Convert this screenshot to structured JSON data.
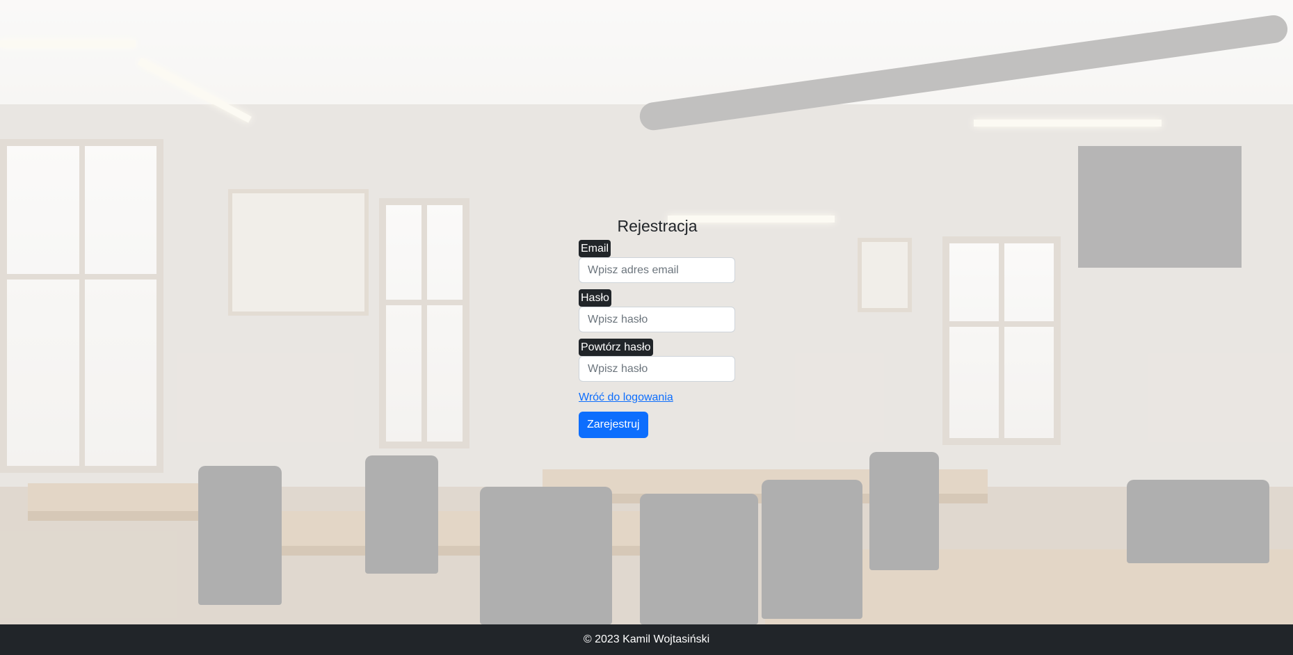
{
  "form": {
    "title": "Rejestracja",
    "email_label": "Email",
    "email_placeholder": "Wpisz adres email",
    "password_label": "Hasło",
    "password_placeholder": "Wpisz hasło",
    "repeat_label": "Powtórz hasło",
    "repeat_placeholder": "Wpisz hasło",
    "back_link": "Wróć do logowania",
    "submit_label": "Zarejestruj"
  },
  "footer": {
    "text": "© 2023 Kamil Wojtasiński"
  },
  "colors": {
    "primary": "#0d6efd",
    "dark": "#212529"
  }
}
